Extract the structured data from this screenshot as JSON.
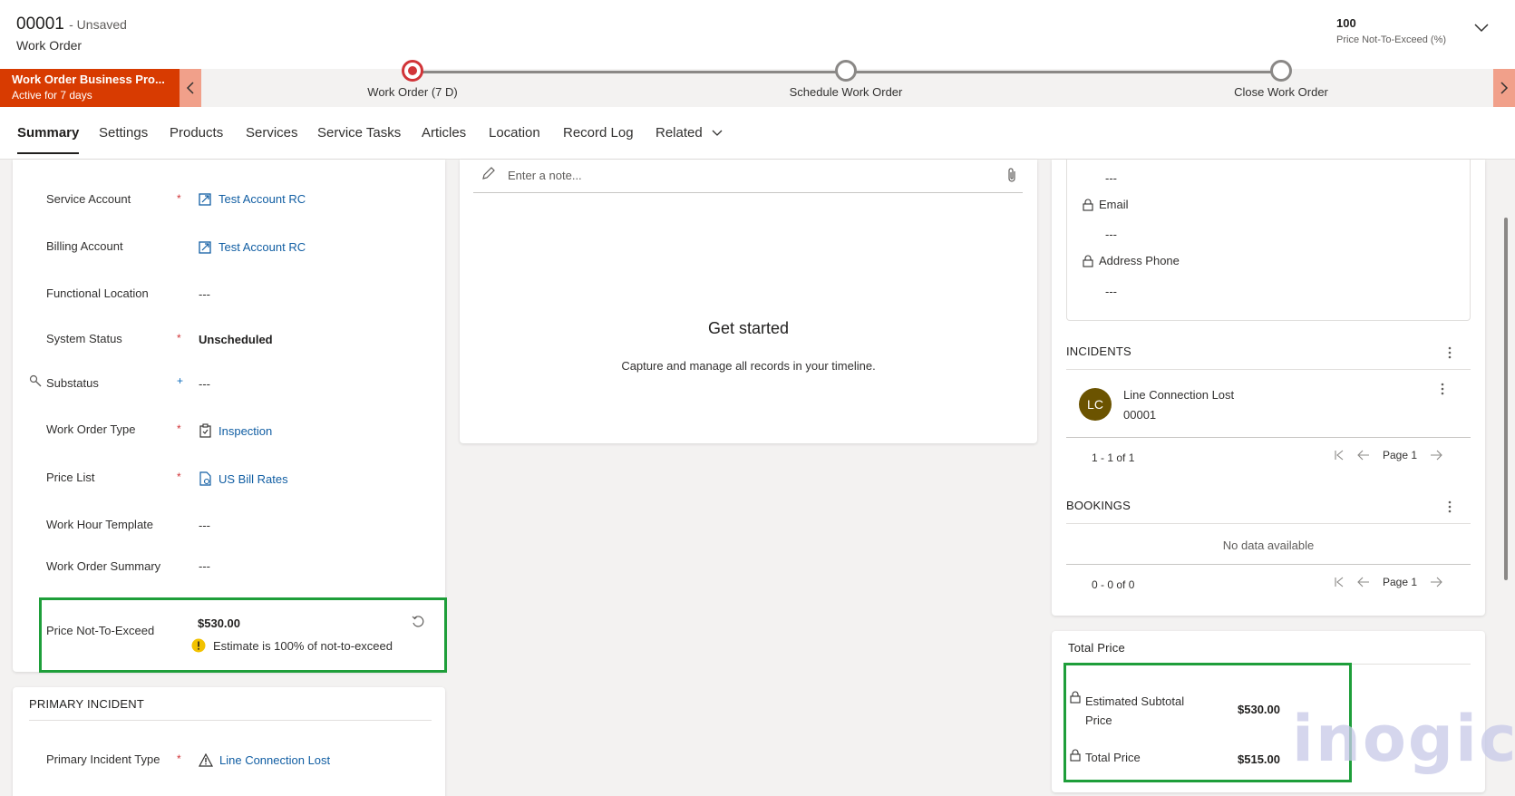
{
  "header": {
    "record_id": "00001",
    "unsaved": "- Unsaved",
    "entity": "Work Order",
    "hdr_field_value": "100",
    "hdr_field_label": "Price Not-To-Exceed (%)"
  },
  "bpf": {
    "flag_title": "Work Order Business Pro...",
    "flag_sub": "Active for 7 days",
    "stages": [
      {
        "label": "Work Order  (7 D)"
      },
      {
        "label": "Schedule Work Order"
      },
      {
        "label": "Close Work Order"
      }
    ]
  },
  "tabs": [
    "Summary",
    "Settings",
    "Products",
    "Services",
    "Service Tasks",
    "Articles",
    "Location",
    "Record Log",
    "Related"
  ],
  "general": {
    "fields": [
      {
        "label": "Service Account",
        "value": "Test Account RC"
      },
      {
        "label": "Billing Account",
        "value": "Test Account RC"
      },
      {
        "label": "Functional Location",
        "value": "---"
      },
      {
        "label": "System Status",
        "value": "Unscheduled"
      },
      {
        "label": "Substatus",
        "value": "---"
      },
      {
        "label": "Work Order Type",
        "value": "Inspection"
      },
      {
        "label": "Price List",
        "value": "US Bill Rates"
      },
      {
        "label": "Work Hour Template",
        "value": "---"
      },
      {
        "label": "Work Order Summary",
        "value": "---"
      }
    ],
    "pnte_label": "Price Not-To-Exceed",
    "pnte_value": "$530.00",
    "pnte_warning": "Estimate is 100% of not-to-exceed"
  },
  "primary_incident": {
    "title": "PRIMARY INCIDENT",
    "type_label": "Primary Incident Type",
    "type_value": "Line Connection Lost"
  },
  "timeline": {
    "placeholder": "Enter a note...",
    "heading": "Get started",
    "subtext": "Capture and manage all records in your timeline."
  },
  "contact": {
    "value1": "---",
    "email_label": "Email",
    "email_value": "---",
    "phone_label": "Address Phone",
    "phone_value": "---"
  },
  "incidents": {
    "title": "INCIDENTS",
    "avatar": "LC",
    "item_title": "Line Connection Lost",
    "item_sub": "00001",
    "pager": "1 - 1 of 1",
    "page": "Page 1"
  },
  "bookings": {
    "title": "BOOKINGS",
    "empty": "No data available",
    "pager": "0 - 0 of 0",
    "page": "Page 1"
  },
  "total_price": {
    "title": "Total Price",
    "est_label_1": "Estimated Subtotal",
    "est_label_2": "Price",
    "est_value": "$530.00",
    "total_label": "Total Price",
    "total_value": "$515.00"
  },
  "watermark": "inogic",
  "colors": {
    "bpf_active": "#d83b01",
    "link": "#115ea3",
    "highlight": "#1e9e3a",
    "required": "#d13438",
    "warning": "#f2c200"
  }
}
